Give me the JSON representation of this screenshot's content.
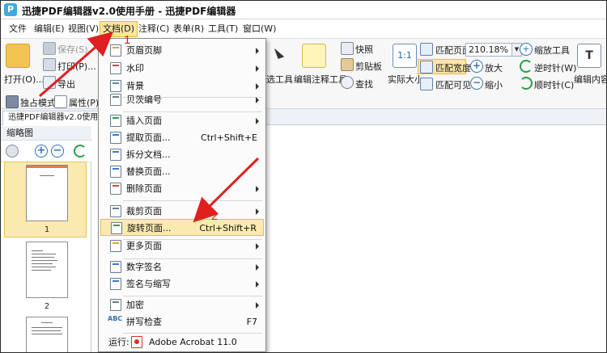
{
  "window": {
    "title": "迅捷PDF编辑器v2.0使用手册 - 迅捷PDF编辑器",
    "logo_letter": "P"
  },
  "menubar": {
    "items": [
      {
        "label": "文件"
      },
      {
        "label": "编辑(E)"
      },
      {
        "label": "视图(V)"
      },
      {
        "label": "文档(D)"
      },
      {
        "label": "注释(C)"
      },
      {
        "label": "表单(R)"
      },
      {
        "label": "工具(T)"
      },
      {
        "label": "窗口(W)"
      }
    ],
    "active_index": 3
  },
  "ribbon": {
    "open": "打开(O)...",
    "save": "保存(S)",
    "print": "打印(P)...",
    "export": "导出",
    "exclusive_mode": "独占模式",
    "properties": "属性(P)...",
    "select_tool": "选工具",
    "edit_annotation_tool": "编辑注释工具",
    "snapshot": "快照",
    "clipboard": "剪贴板",
    "find": "查找",
    "actual_size": "实际大小",
    "fit_page": "匹配页面",
    "fit_width": "匹配宽度",
    "fit_visible": "匹配可见",
    "zoom_value": "210.18%",
    "zoom_tool": "缩放工具",
    "zoom_in": "放大",
    "zoom_out": "缩小",
    "rotate_ccw": "逆时针(W)",
    "rotate_cw": "顺时针(C)",
    "edit_content": "编辑内容"
  },
  "doc_tab": {
    "label": "迅捷PDF编辑器v2.0使用手册"
  },
  "thumbnails": {
    "title": "缩略图",
    "pages": [
      "1",
      "2"
    ]
  },
  "document_menu": {
    "items": [
      {
        "label": "页眉页脚",
        "shortcut": "",
        "submenu": true,
        "icon": "header-footer-icon"
      },
      {
        "label": "水印",
        "shortcut": "",
        "submenu": true,
        "icon": "watermark-icon"
      },
      {
        "label": "背景",
        "shortcut": "",
        "submenu": true,
        "icon": "background-icon"
      },
      {
        "label": "贝茨编号",
        "shortcut": "",
        "submenu": true,
        "icon": "bates-number-icon"
      },
      {
        "label": "插入页面",
        "shortcut": "",
        "submenu": true,
        "icon": "insert-page-icon"
      },
      {
        "label": "提取页面...",
        "shortcut": "Ctrl+Shift+E",
        "submenu": false,
        "icon": "extract-page-icon"
      },
      {
        "label": "拆分文档...",
        "shortcut": "",
        "submenu": false,
        "icon": "split-document-icon"
      },
      {
        "label": "替换页面...",
        "shortcut": "",
        "submenu": false,
        "icon": "replace-page-icon"
      },
      {
        "label": "删除页面",
        "shortcut": "",
        "submenu": true,
        "icon": "delete-page-icon"
      },
      {
        "label": "裁剪页面",
        "shortcut": "",
        "submenu": true,
        "icon": "crop-page-icon"
      },
      {
        "label": "旋转页面...",
        "shortcut": "Ctrl+Shift+R",
        "submenu": false,
        "icon": "rotate-page-icon"
      },
      {
        "label": "更多页面",
        "shortcut": "",
        "submenu": true,
        "icon": "more-pages-icon"
      },
      {
        "label": "数字签名",
        "shortcut": "",
        "submenu": true,
        "icon": "digital-signature-icon"
      },
      {
        "label": "签名与缩写",
        "shortcut": "",
        "submenu": true,
        "icon": "sign-initial-icon"
      },
      {
        "label": "加密",
        "shortcut": "",
        "submenu": true,
        "icon": "encrypt-icon"
      },
      {
        "label": "拼写检查",
        "shortcut": "F7",
        "submenu": false,
        "icon": "spell-check-icon"
      }
    ],
    "run_label": "运行:",
    "run_target": "Adobe Acrobat 11.0",
    "spell_icon_text": "ABC"
  },
  "annotations": {
    "step1": "1",
    "step2": "2"
  },
  "colors": {
    "accent": "#2f71b8",
    "highlight": "#fbeab0",
    "annotation": "#e02020"
  }
}
